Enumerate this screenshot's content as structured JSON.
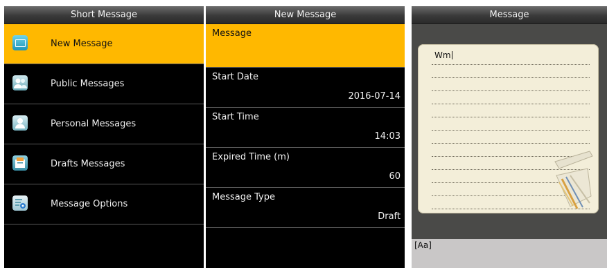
{
  "panels": {
    "short_message": {
      "title": "Short Message",
      "items": [
        {
          "label": "New Message",
          "icon": "envelope-icon"
        },
        {
          "label": "Public Messages",
          "icon": "people-icon"
        },
        {
          "label": "Personal Messages",
          "icon": "person-icon"
        },
        {
          "label": "Drafts Messages",
          "icon": "drafts-icon"
        },
        {
          "label": "Message Options",
          "icon": "options-icon"
        }
      ]
    },
    "new_message": {
      "title": "New Message",
      "fields": [
        {
          "label": "Message",
          "value": ""
        },
        {
          "label": "Start Date",
          "value": "2016-07-14"
        },
        {
          "label": "Start Time",
          "value": "14:03"
        },
        {
          "label": "Expired Time (m)",
          "value": "60"
        },
        {
          "label": "Message Type",
          "value": "Draft"
        }
      ]
    },
    "message": {
      "title": "Message",
      "text": "Wm",
      "input_mode": "[Aa]"
    }
  },
  "colors": {
    "accent": "#ffb800",
    "background": "#000000"
  }
}
